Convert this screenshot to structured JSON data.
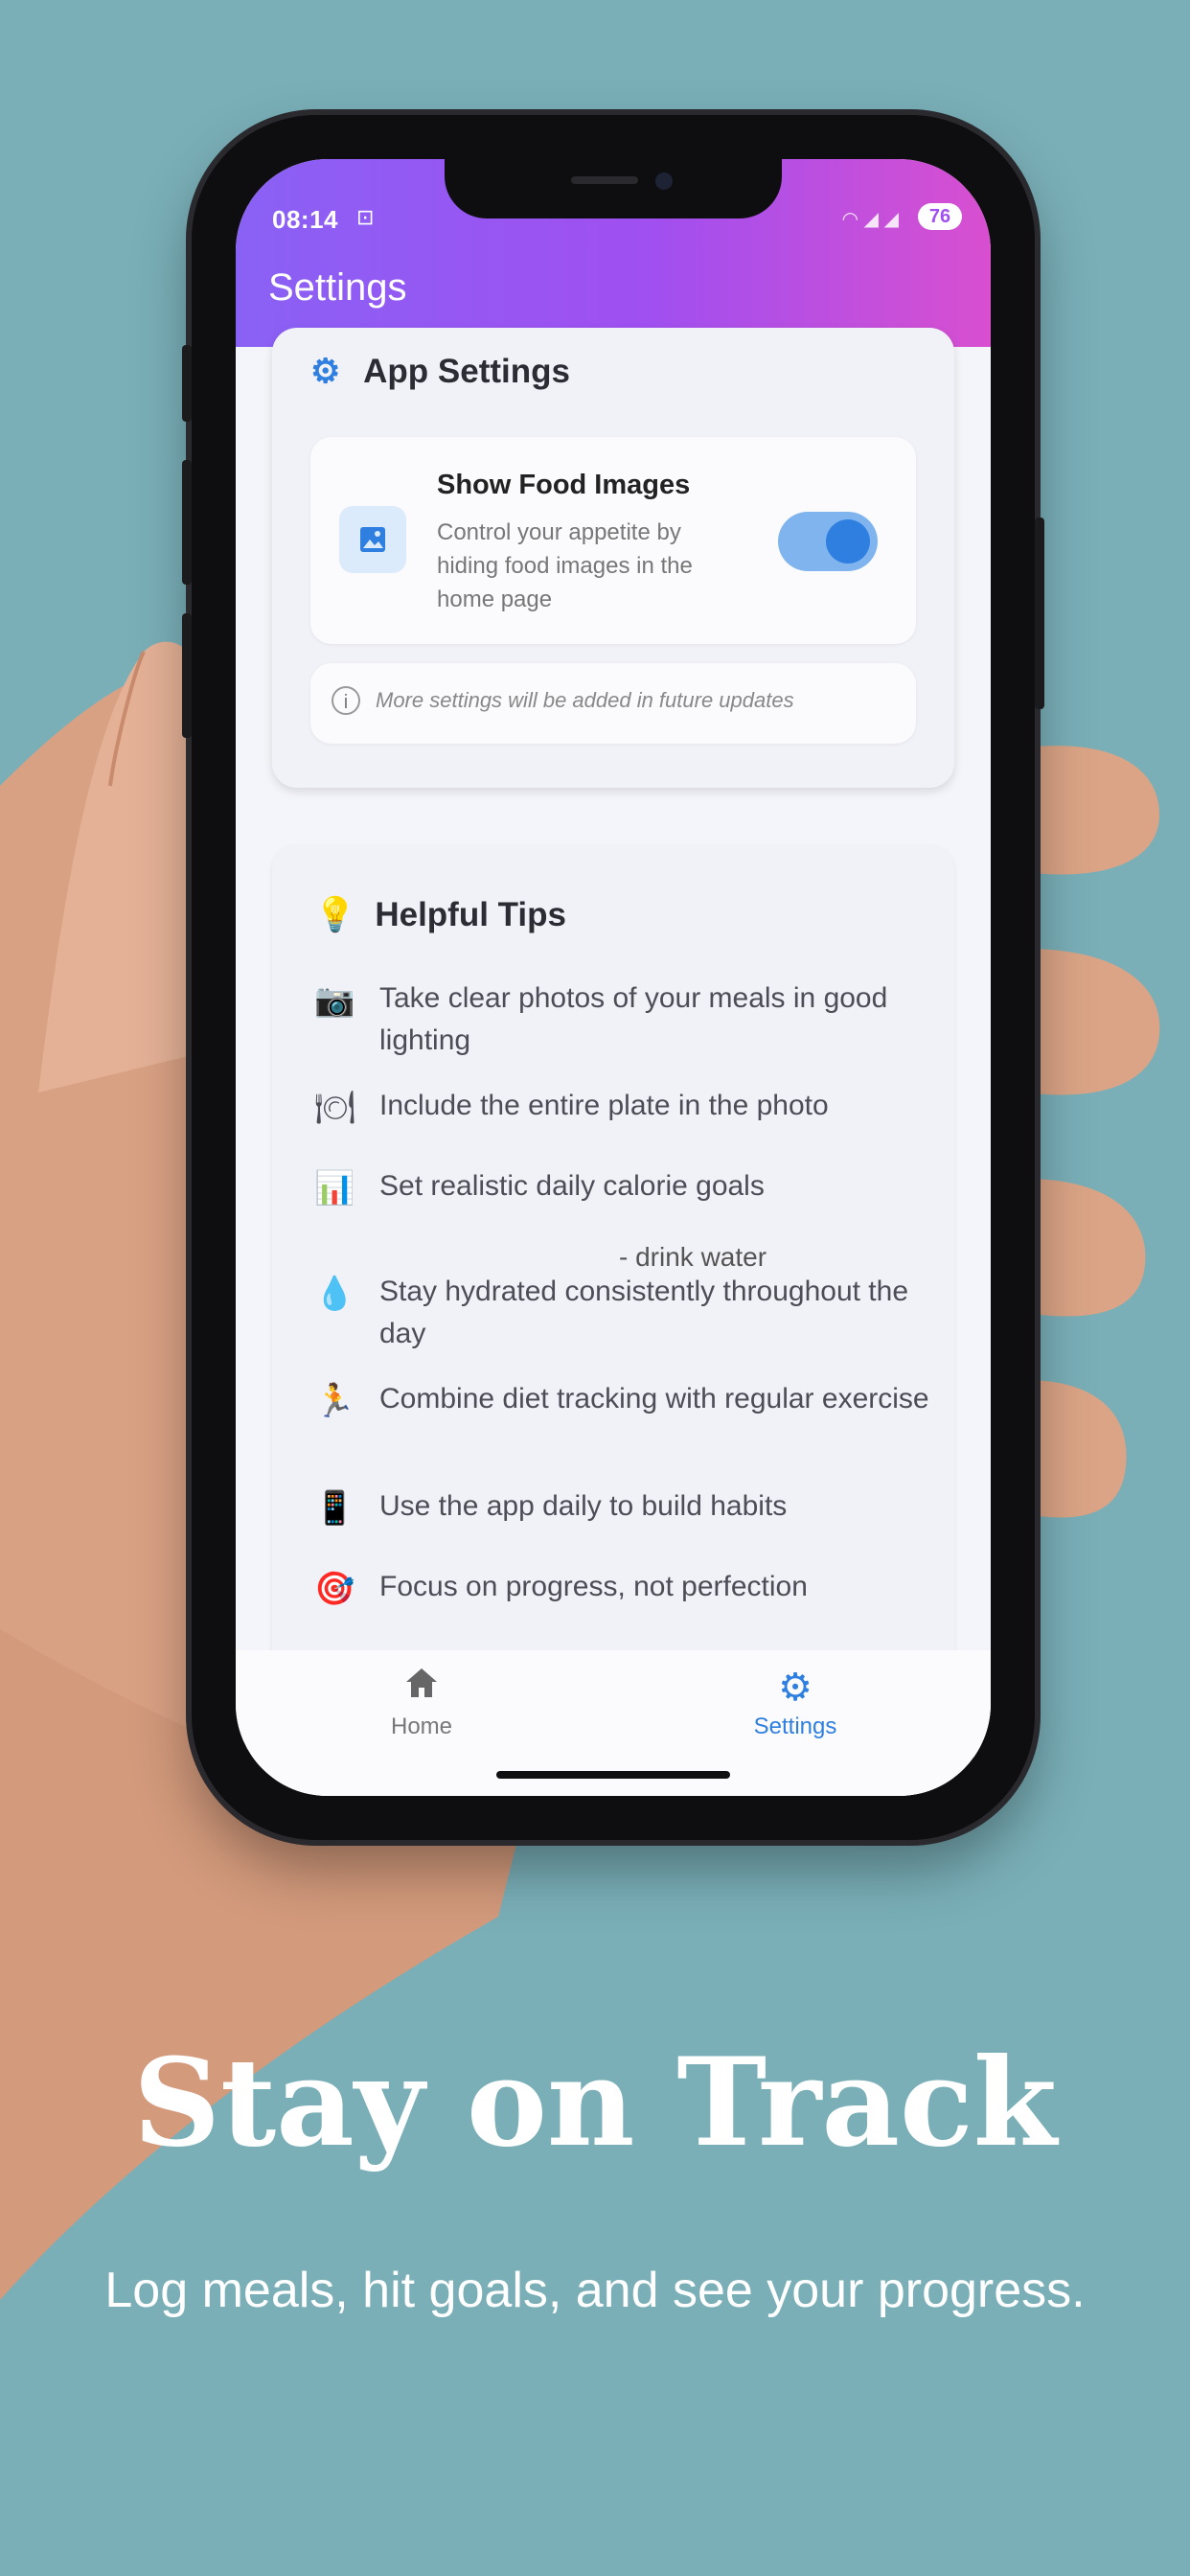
{
  "status_bar": {
    "time": "08:14",
    "battery": "76"
  },
  "app_bar": {
    "title": "Settings"
  },
  "app_settings": {
    "title": "App Settings",
    "show_food_images": {
      "title": "Show Food Images",
      "description": "Control your appetite by hiding food images in the home page",
      "enabled": true
    },
    "note": "More settings will be added in future updates"
  },
  "helpful_tips": {
    "title": "Helpful Tips",
    "items": [
      {
        "icon": "camera-icon",
        "text": "Take clear photos of your meals in good lighting"
      },
      {
        "icon": "plate-icon",
        "text": "Include the entire plate in the photo"
      },
      {
        "icon": "bar-chart-icon",
        "text": "Set realistic daily calorie goals"
      },
      {
        "icon": "water-drop-icon",
        "text": "Stay hydrated consistently throughout the day"
      },
      {
        "icon": "running-icon",
        "text": "Combine diet tracking with regular exercise"
      },
      {
        "icon": "phone-icon",
        "text": "Use the app daily to build habits"
      },
      {
        "icon": "target-icon",
        "text": "Focus on progress, not perfection"
      }
    ],
    "overlay_text": "- drink water"
  },
  "bottom_nav": {
    "items": [
      {
        "label": "Home",
        "icon": "home-icon",
        "active": false
      },
      {
        "label": "Settings",
        "icon": "gear-icon",
        "active": true
      }
    ]
  },
  "promo": {
    "headline": "Stay on Track",
    "subline": "Log meals, hit goals, and see your progress."
  },
  "colors": {
    "background": "#7aafb8",
    "accent": "#2f7fe0",
    "gradient_start": "#8a61f5",
    "gradient_end": "#d84fd0"
  }
}
